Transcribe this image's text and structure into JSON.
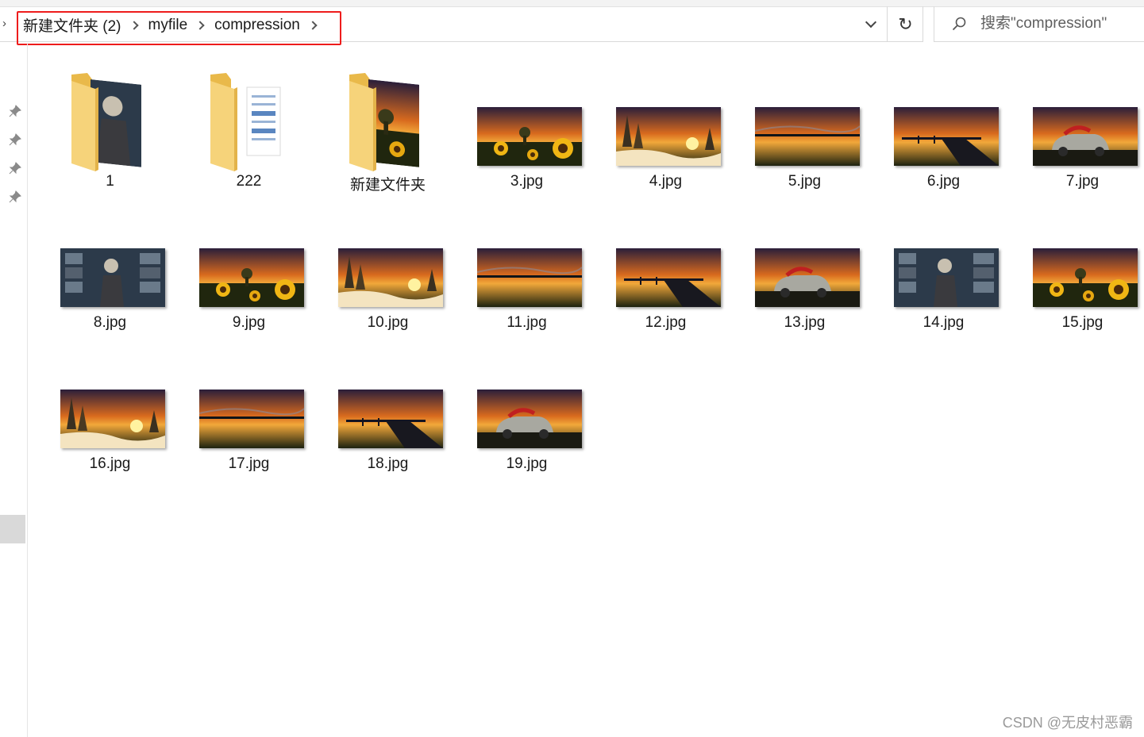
{
  "breadcrumb": {
    "items": [
      "新建文件夹 (2)",
      "myfile",
      "compression"
    ]
  },
  "search": {
    "placeholder": "搜索\"compression\""
  },
  "items": [
    {
      "label": "1",
      "kind": "folder",
      "preview": "poster"
    },
    {
      "label": "222",
      "kind": "folder",
      "preview": "document"
    },
    {
      "label": "新建文件夹",
      "kind": "folder",
      "preview": "sunflower"
    },
    {
      "label": "3.jpg",
      "kind": "image",
      "scene": "sunflower"
    },
    {
      "label": "4.jpg",
      "kind": "image",
      "scene": "snowsun"
    },
    {
      "label": "5.jpg",
      "kind": "image",
      "scene": "lake"
    },
    {
      "label": "6.jpg",
      "kind": "image",
      "scene": "pier"
    },
    {
      "label": "7.jpg",
      "kind": "image",
      "scene": "car"
    },
    {
      "label": "8.jpg",
      "kind": "image",
      "scene": "poster"
    },
    {
      "label": "9.jpg",
      "kind": "image",
      "scene": "sunflower"
    },
    {
      "label": "10.jpg",
      "kind": "image",
      "scene": "snowsun"
    },
    {
      "label": "11.jpg",
      "kind": "image",
      "scene": "lake"
    },
    {
      "label": "12.jpg",
      "kind": "image",
      "scene": "pier"
    },
    {
      "label": "13.jpg",
      "kind": "image",
      "scene": "car"
    },
    {
      "label": "14.jpg",
      "kind": "image",
      "scene": "poster"
    },
    {
      "label": "15.jpg",
      "kind": "image",
      "scene": "sunflower"
    },
    {
      "label": "16.jpg",
      "kind": "image",
      "scene": "snowsun"
    },
    {
      "label": "17.jpg",
      "kind": "image",
      "scene": "lake"
    },
    {
      "label": "18.jpg",
      "kind": "image",
      "scene": "pier"
    },
    {
      "label": "19.jpg",
      "kind": "image",
      "scene": "car"
    }
  ],
  "watermark": "CSDN @无皮村恶霸",
  "colors": {
    "highlight_box": "#ee1c1c",
    "folder": "#f5cd6a"
  }
}
